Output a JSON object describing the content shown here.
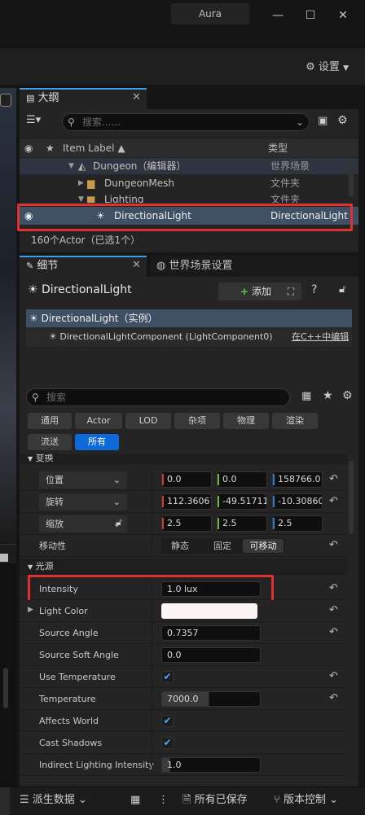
{
  "window": {
    "title": "Aura",
    "min": "—",
    "max": "☐",
    "close": "✕"
  },
  "toolbar": {
    "settings_label": "设置"
  },
  "outline": {
    "tab": "大纲",
    "search_placeholder": "搜索......",
    "columns": {
      "label": "Item Label ▲",
      "type": "类型"
    },
    "rows": [
      {
        "label": "Dungeon（编辑器）",
        "type": "世界场景"
      },
      {
        "label": "DungeonMesh",
        "type": "文件夹"
      },
      {
        "label": "Lighting",
        "type": "文件夹"
      },
      {
        "label": "DirectionalLight",
        "type": "DirectionalLight"
      }
    ],
    "status": "160个Actor（已选1个）"
  },
  "details": {
    "tab": "细节",
    "tab2": "世界场景设置",
    "actor_name": "DirectionalLight",
    "add_label": "添加",
    "comp_root": "DirectionalLight（实例）",
    "comp_child": "DirectionalLightComponent (LightComponent0)",
    "comp_edit": "在C++中编辑",
    "search_placeholder": "搜索",
    "filters": [
      "通用",
      "Actor",
      "LOD",
      "杂项",
      "物理",
      "渲染",
      "流送",
      "所有"
    ],
    "transform_section": "变换",
    "location": {
      "label": "位置",
      "x": "0.0",
      "y": "0.0",
      "z": "158766.0"
    },
    "rotation": {
      "label": "旋转",
      "x": "112.36067",
      "y": "-49.51711",
      "z": "-10.30860"
    },
    "scale": {
      "label": "缩放",
      "x": "2.5",
      "y": "2.5",
      "z": "2.5"
    },
    "mobility": {
      "label": "移动性",
      "opts": [
        "静态",
        "固定",
        "可移动"
      ]
    },
    "light_section": "光源",
    "intensity": {
      "label": "Intensity",
      "value": "1.0 lux"
    },
    "light_color": {
      "label": "Light Color"
    },
    "source_angle": {
      "label": "Source Angle",
      "value": "0.7357"
    },
    "source_soft_angle": {
      "label": "Source Soft Angle",
      "value": "0.0"
    },
    "use_temperature": {
      "label": "Use Temperature"
    },
    "temperature": {
      "label": "Temperature",
      "value": "7000.0"
    },
    "affects_world": {
      "label": "Affects World"
    },
    "cast_shadows": {
      "label": "Cast Shadows"
    },
    "indirect": {
      "label": "Indirect Lighting Intensity",
      "value": "1.0"
    }
  },
  "statusbar": {
    "derived": "派生数据",
    "saved": "所有已保存",
    "vcs": "版本控制"
  },
  "colors": {
    "accent": "#0e6ad8",
    "highlight": "#e03030",
    "selection": "#3f5064"
  }
}
